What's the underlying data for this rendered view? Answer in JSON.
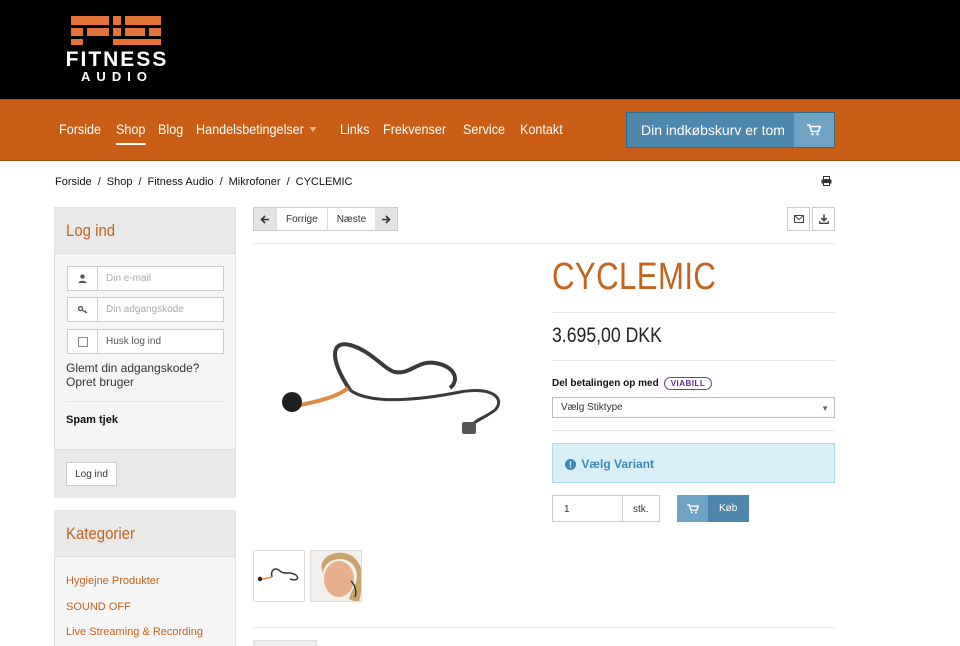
{
  "brand": {
    "logo_line1": "FITNESS",
    "logo_line2": "AUDIO",
    "colors": {
      "primary": "#c95d15",
      "accent_text": "#c2641d",
      "cart_blue": "#4d87ab",
      "header_bg": "#000000"
    }
  },
  "nav": {
    "items": [
      {
        "label": "Forside"
      },
      {
        "label": "Shop"
      },
      {
        "label": "Blog"
      },
      {
        "label": "Handelsbetingelser"
      },
      {
        "label": "Links"
      },
      {
        "label": "Frekvenser"
      },
      {
        "label": "Service"
      },
      {
        "label": "Kontakt"
      }
    ],
    "active": "Shop",
    "cart_label": "Din indkøbskurv er tom",
    "cart_icon": "shopping-cart-icon"
  },
  "breadcrumb": {
    "items": [
      "Forside",
      "Shop",
      "Fitness Audio",
      "Mikrofoner",
      "CYCLEMIC"
    ],
    "separator": "/"
  },
  "sidebar": {
    "login": {
      "title": "Log ind",
      "email_placeholder": "Din e-mail",
      "password_placeholder": "Din adgangskode",
      "remember_label": "Husk log ind",
      "forgot_link": "Glemt din adgangskode?",
      "register_link": "Opret bruger",
      "spam_label": "Spam tjek",
      "submit_label": "Log ind"
    },
    "categories": {
      "title": "Kategorier",
      "items": [
        "Hygiejne Produkter",
        "SOUND OFF",
        "Live Streaming & Recording"
      ]
    }
  },
  "product_nav": {
    "prev_label": "Forrige",
    "next_label": "Næste"
  },
  "product": {
    "name": "CYCLEMIC",
    "price": "3.695,00 DKK",
    "financing_label": "Del betalingen op med",
    "financing_badge": "VIABILL",
    "select_placeholder": "Vælg Stiktype",
    "variant_alert": "Vælg Variant",
    "quantity": "1",
    "unit": "stk.",
    "buy_label": "Køb"
  }
}
